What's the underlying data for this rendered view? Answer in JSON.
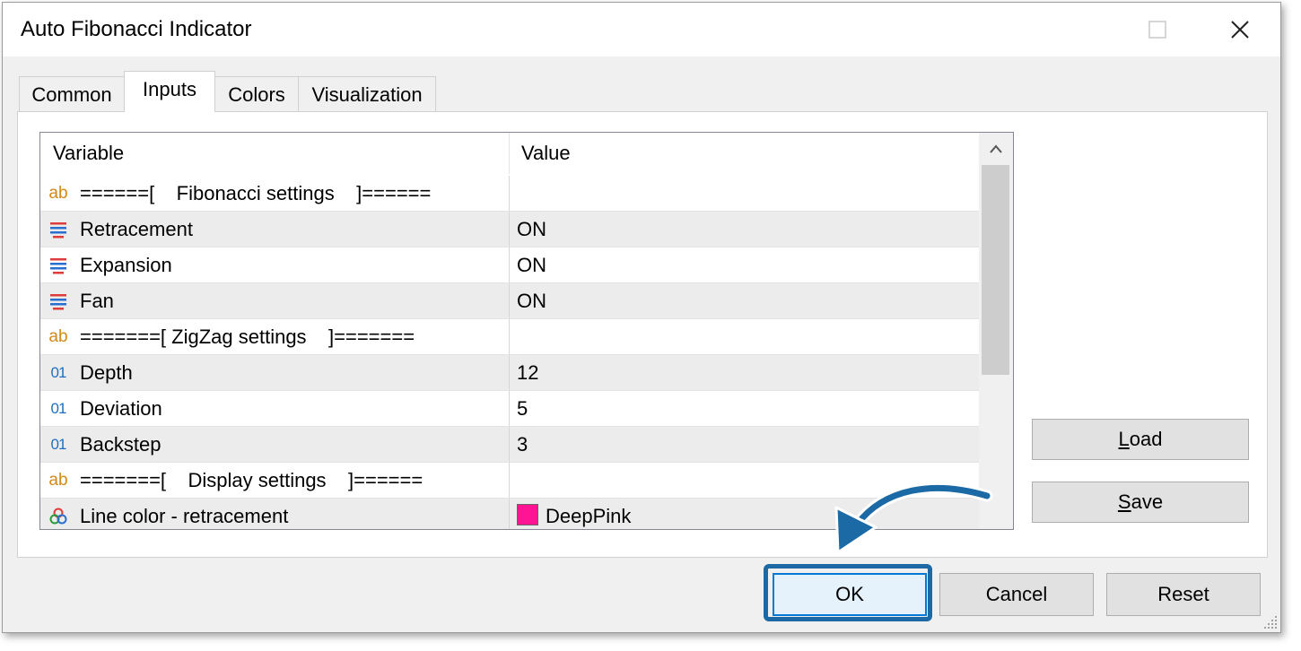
{
  "window": {
    "title": "Auto Fibonacci Indicator"
  },
  "tabs": [
    {
      "label": "Common",
      "active": false
    },
    {
      "label": "Inputs",
      "active": true
    },
    {
      "label": "Colors",
      "active": false
    },
    {
      "label": "Visualization",
      "active": false
    }
  ],
  "grid": {
    "headers": {
      "variable": "Variable",
      "value": "Value"
    },
    "rows": [
      {
        "icon": "ab-text-icon",
        "variable": "======[    Fibonacci settings    ]======",
        "value": ""
      },
      {
        "icon": "enum-list-icon",
        "variable": "Retracement",
        "value": "ON"
      },
      {
        "icon": "enum-list-icon",
        "variable": "Expansion",
        "value": "ON"
      },
      {
        "icon": "enum-list-icon",
        "variable": "Fan",
        "value": "ON"
      },
      {
        "icon": "ab-text-icon",
        "variable": "=======[ ZigZag settings    ]=======",
        "value": ""
      },
      {
        "icon": "integer-01-icon",
        "variable": "Depth",
        "value": "12"
      },
      {
        "icon": "integer-01-icon",
        "variable": "Deviation",
        "value": "5"
      },
      {
        "icon": "integer-01-icon",
        "variable": "Backstep",
        "value": "3"
      },
      {
        "icon": "ab-text-icon",
        "variable": "=======[    Display settings    ]======",
        "value": ""
      },
      {
        "icon": "color-circles-icon",
        "variable": "Line color - retracement",
        "value": "DeepPink",
        "swatch": "#ff1493"
      }
    ]
  },
  "side_buttons": {
    "load": {
      "accel": "L",
      "rest": "oad"
    },
    "save": {
      "accel": "S",
      "rest": "ave"
    }
  },
  "buttons": {
    "ok": "OK",
    "cancel": "Cancel",
    "reset": "Reset"
  },
  "colors": {
    "highlight": "#1b6aa5",
    "ok_focus": "#0078d7",
    "ab_icon": "#d2891a",
    "num_icon": "#1f6fbf"
  }
}
